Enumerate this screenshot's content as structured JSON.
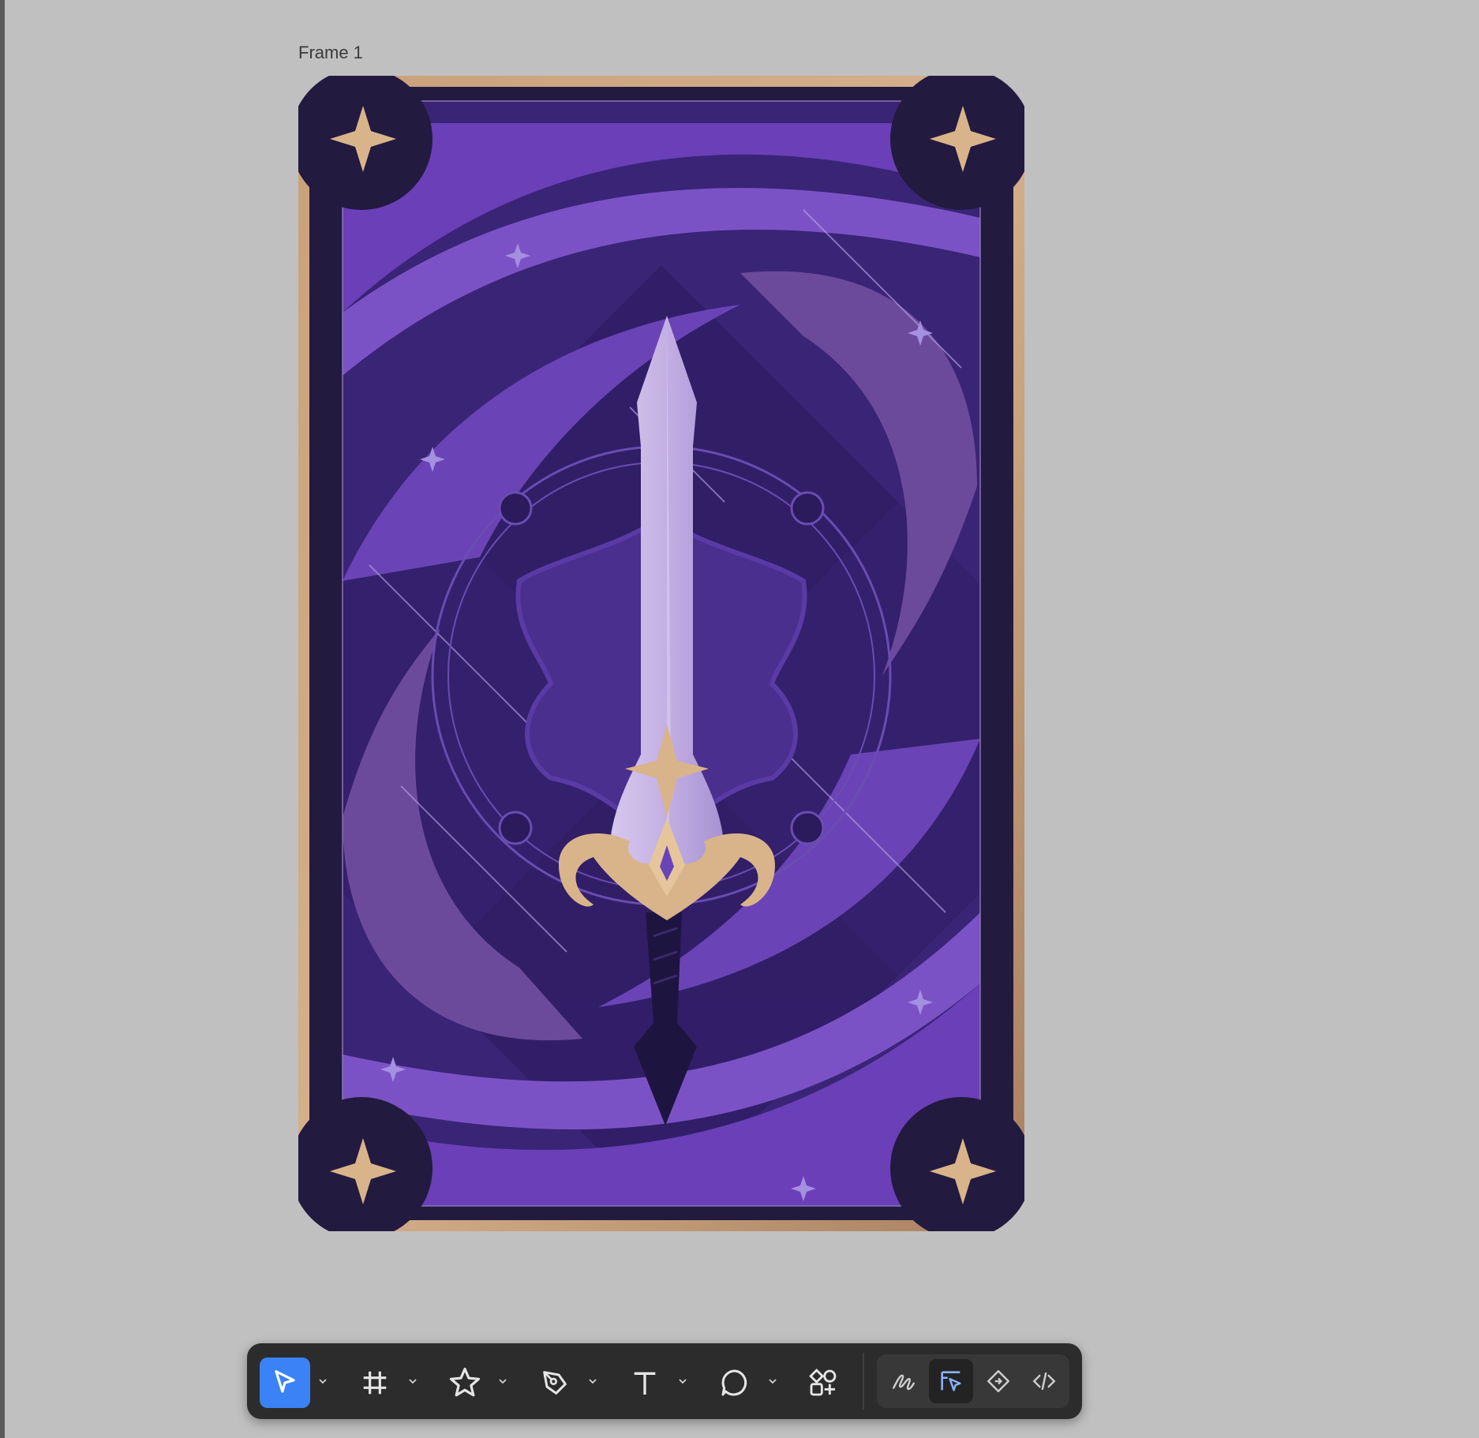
{
  "canvas": {
    "background": "#c0c0c0",
    "frame_label": "Frame 1"
  },
  "artwork": {
    "description_icon": "sword-card-illustration",
    "colors": {
      "gold": "#d9b48a",
      "border": "#b88f6b",
      "dark": "#221a3f",
      "purple_deep": "#3a2476",
      "purple": "#5a34a8",
      "purple_light": "#7d52c8",
      "blade": "#c8b4e6"
    }
  },
  "toolbar": {
    "tools": [
      {
        "name": "move-tool",
        "icon": "cursor-icon",
        "active": true,
        "has_menu": true
      },
      {
        "name": "frame-tool",
        "icon": "hash-frame-icon",
        "active": false,
        "has_menu": true
      },
      {
        "name": "shape-tool",
        "icon": "star-icon",
        "active": false,
        "has_menu": true
      },
      {
        "name": "pen-tool",
        "icon": "pen-icon",
        "active": false,
        "has_menu": true
      },
      {
        "name": "text-tool",
        "icon": "text-icon",
        "active": false,
        "has_menu": true
      },
      {
        "name": "comment-tool",
        "icon": "comment-icon",
        "active": false,
        "has_menu": true
      },
      {
        "name": "actions-tool",
        "icon": "components-icon",
        "active": false,
        "has_menu": false
      }
    ],
    "modes": [
      {
        "name": "draw-mode",
        "icon": "draw-icon",
        "selected": false
      },
      {
        "name": "design-mode",
        "icon": "design-icon",
        "selected": true
      },
      {
        "name": "prototype-mode",
        "icon": "prototype-icon",
        "selected": false
      },
      {
        "name": "dev-mode",
        "icon": "code-icon",
        "selected": false
      }
    ],
    "accent": "#3b82f6"
  }
}
